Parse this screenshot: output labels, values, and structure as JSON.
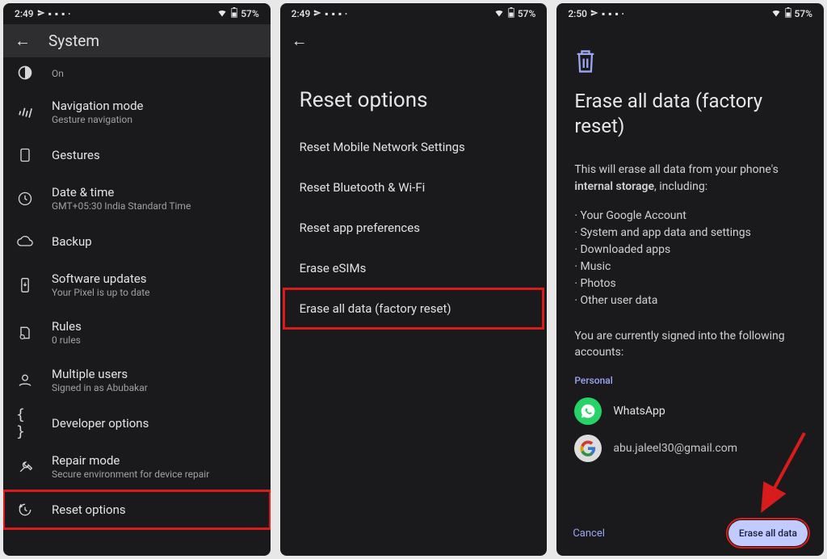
{
  "status1": {
    "time": "2:49",
    "battery": "57%"
  },
  "status2": {
    "time": "2:49",
    "battery": "57%"
  },
  "status3": {
    "time": "2:50",
    "battery": "57%"
  },
  "screen1": {
    "title": "System",
    "items": [
      {
        "title": "",
        "sub": "On"
      },
      {
        "title": "Navigation mode",
        "sub": "Gesture navigation"
      },
      {
        "title": "Gestures",
        "sub": ""
      },
      {
        "title": "Date & time",
        "sub": "GMT+05:30 India Standard Time"
      },
      {
        "title": "Backup",
        "sub": ""
      },
      {
        "title": "Software updates",
        "sub": "Your Pixel is up to date"
      },
      {
        "title": "Rules",
        "sub": "0 rules"
      },
      {
        "title": "Multiple users",
        "sub": "Signed in as Abubakar"
      },
      {
        "title": "Developer options",
        "sub": ""
      },
      {
        "title": "Repair mode",
        "sub": "Secure environment for device repair"
      },
      {
        "title": "Reset options",
        "sub": ""
      }
    ]
  },
  "screen2": {
    "title": "Reset options",
    "options": [
      "Reset Mobile Network Settings",
      "Reset Bluetooth & Wi-Fi",
      "Reset app preferences",
      "Erase eSIMs",
      "Erase all data (factory reset)"
    ]
  },
  "screen3": {
    "title": "Erase all data (factory reset)",
    "desc_pre": "This will erase all data from your phone's ",
    "desc_bold": "internal storage",
    "desc_post": ", including:",
    "bullets": [
      "Your Google Account",
      "System and app data and settings",
      "Downloaded apps",
      "Music",
      "Photos",
      "Other user data"
    ],
    "accounts_hint": "You are currently signed into the following accounts:",
    "section": "Personal",
    "accounts": [
      {
        "name": "WhatsApp"
      },
      {
        "name": "abu.jaleel30@gmail.com"
      }
    ],
    "cancel": "Cancel",
    "erase": "Erase all data"
  }
}
